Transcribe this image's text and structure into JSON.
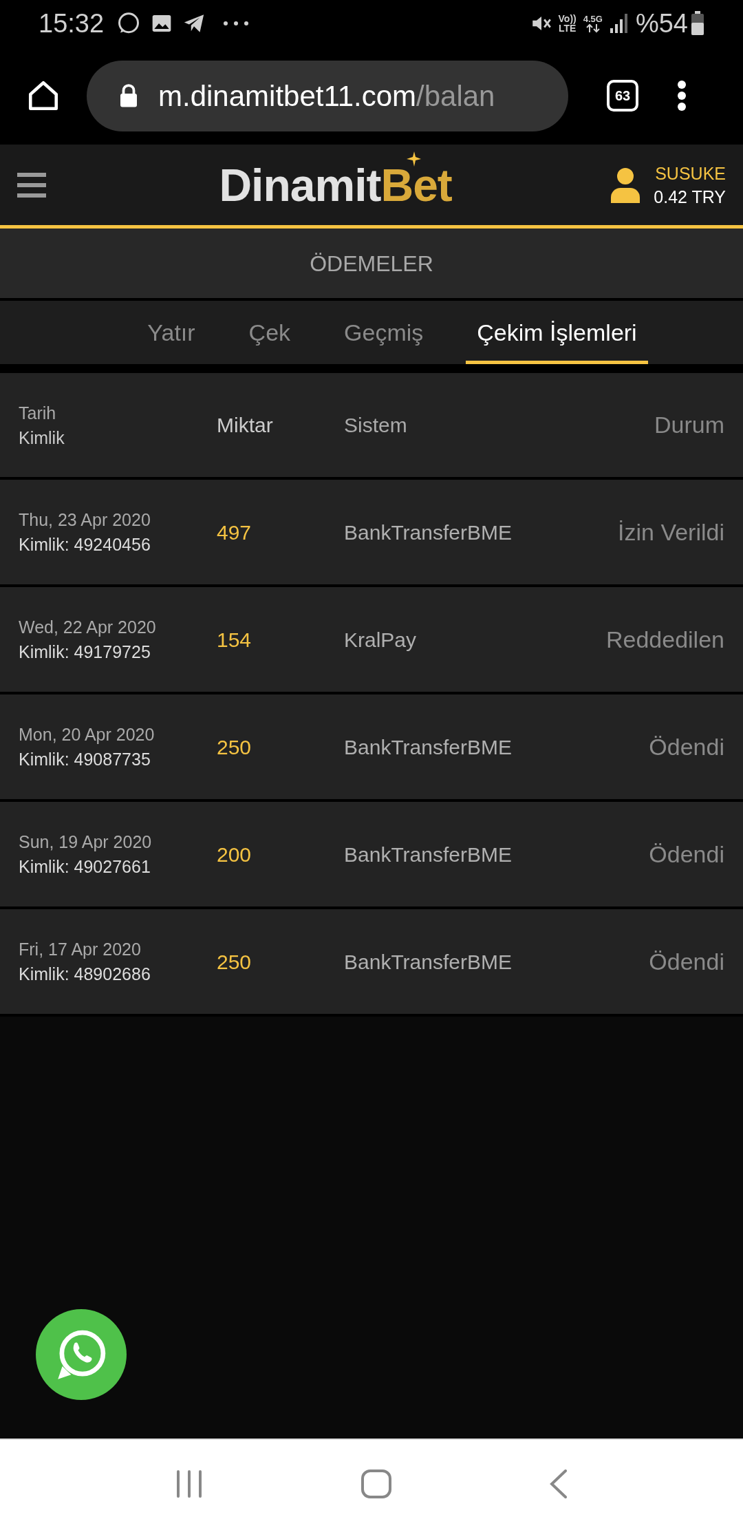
{
  "status_bar": {
    "time": "15:32",
    "volte_label": "Vo))",
    "lte_label": "LTE",
    "network_label": "4.5G",
    "battery": "%54"
  },
  "browser": {
    "domain": "m.dinamitbet11.com",
    "path": "/balan",
    "tab_count": "63"
  },
  "header": {
    "logo": {
      "text": "Dinamit",
      "accent": "Bet"
    },
    "username": "SUSUKE",
    "balance": "0.42 TRY"
  },
  "page_title": "ÖDEMELER",
  "tabs": [
    {
      "label": "Yatır",
      "selected": false
    },
    {
      "label": "Çek",
      "selected": false
    },
    {
      "label": "Geçmiş",
      "selected": false
    },
    {
      "label": "Çekim İşlemleri",
      "selected": true
    }
  ],
  "table": {
    "columns": {
      "date": "Tarih",
      "id": "Kimlik",
      "amount": "Miktar",
      "system": "Sistem",
      "status": "Durum"
    },
    "rows": [
      {
        "date": "Thu, 23 Apr 2020",
        "id": "Kimlik: 49240456",
        "amount": "497",
        "system": "BankTransferBME",
        "status": "İzin Verildi"
      },
      {
        "date": "Wed, 22 Apr 2020",
        "id": "Kimlik: 49179725",
        "amount": "154",
        "system": "KralPay",
        "status": "Reddedilen"
      },
      {
        "date": "Mon, 20 Apr 2020",
        "id": "Kimlik: 49087735",
        "amount": "250",
        "system": "BankTransferBME",
        "status": "Ödendi"
      },
      {
        "date": "Sun, 19 Apr 2020",
        "id": "Kimlik: 49027661",
        "amount": "200",
        "system": "BankTransferBME",
        "status": "Ödendi"
      },
      {
        "date": "Fri, 17 Apr 2020",
        "id": "Kimlik: 48902686",
        "amount": "250",
        "system": "BankTransferBME",
        "status": "Ödendi"
      }
    ]
  }
}
